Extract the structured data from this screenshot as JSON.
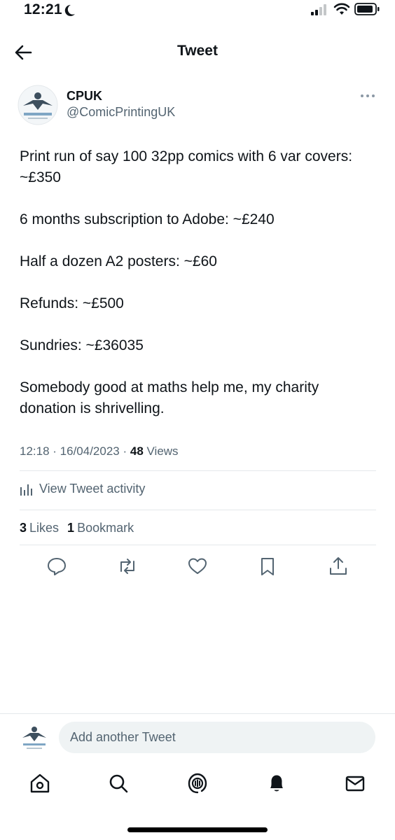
{
  "status_bar": {
    "time": "12:21"
  },
  "header": {
    "title": "Tweet"
  },
  "author": {
    "name": "CPUK",
    "handle": "@ComicPrintingUK"
  },
  "tweet": {
    "paragraphs": [
      "Print run of say 100 32pp comics with 6 var covers: ~£350",
      "6 months subscription to Adobe: ~£240",
      "Half a dozen A2 posters: ~£60",
      "Refunds: ~£500",
      "Sundries: ~£36035",
      "Somebody good at maths help me, my charity donation is shrivelling."
    ],
    "time": "12:18",
    "date": "16/04/2023",
    "views_count": "48",
    "views_label": "Views"
  },
  "activity_label": "View Tweet activity",
  "stats": {
    "likes_count": "3",
    "likes_label": "Likes",
    "bookmarks_count": "1",
    "bookmarks_label": "Bookmark"
  },
  "composer": {
    "placeholder": "Add another Tweet"
  },
  "icons": {
    "back": "back-arrow-icon",
    "more": "more-dots-icon",
    "reply": "reply-icon",
    "retweet": "retweet-icon",
    "like": "heart-icon",
    "bookmark": "bookmark-icon",
    "share": "share-icon",
    "home": "home-icon",
    "search": "search-icon",
    "spaces": "spaces-icon",
    "notifications": "bell-icon",
    "messages": "mail-icon"
  },
  "colors": {
    "text": "#0f1419",
    "secondary": "#536471",
    "divider": "#e4e8eb",
    "input_bg": "#eff3f4"
  }
}
